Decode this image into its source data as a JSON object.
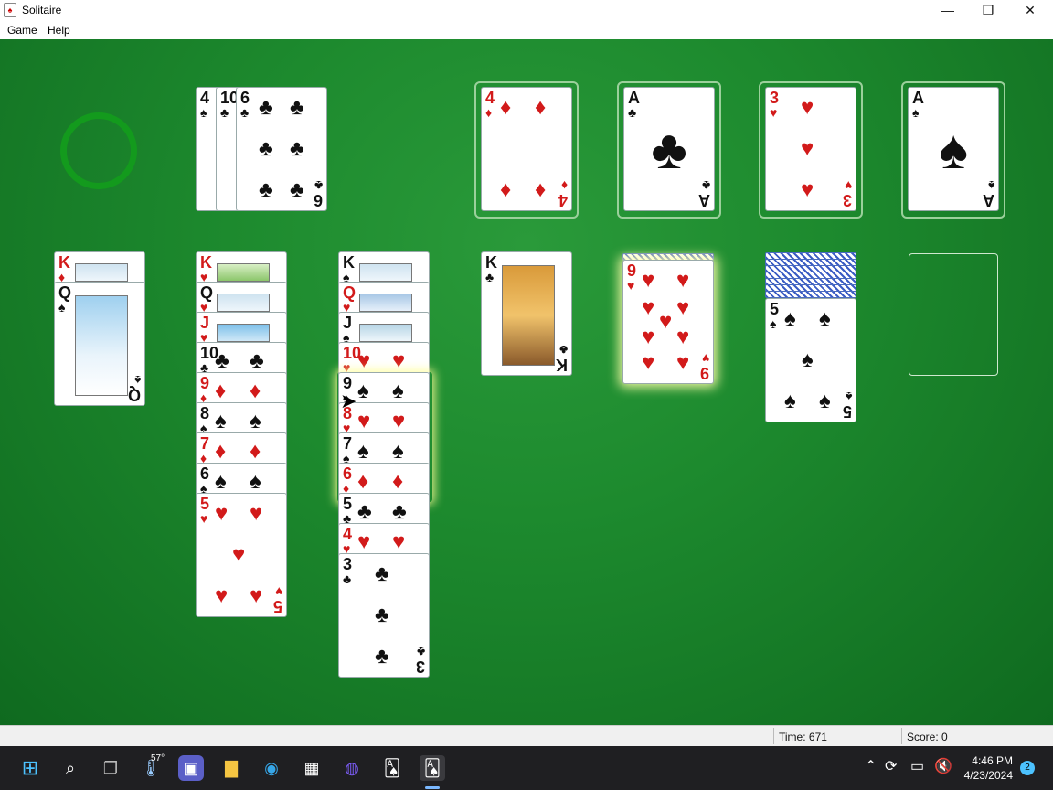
{
  "window": {
    "title": "Solitaire",
    "minimize": "—",
    "restore": "❐",
    "close": "✕"
  },
  "menu": {
    "game": "Game",
    "help": "Help"
  },
  "cards": {
    "waste_1_rank": "4",
    "waste_1_suit": "♠",
    "waste_2_rank": "10",
    "waste_2_suit": "♣",
    "waste_3_rank": "6",
    "waste_3_suit": "♣",
    "fnd_1_rank": "4",
    "fnd_1_suit": "♦",
    "fnd_2_rank": "A",
    "fnd_2_suit": "♣",
    "fnd_3_rank": "3",
    "fnd_3_suit": "♥",
    "fnd_4_rank": "A",
    "fnd_4_suit": "♠",
    "t1": [
      {
        "rank": "K",
        "suit": "♦"
      },
      {
        "rank": "Q",
        "suit": "♠"
      }
    ],
    "t2": [
      {
        "rank": "K",
        "suit": "♥"
      },
      {
        "rank": "Q",
        "suit": "♥"
      },
      {
        "rank": "J",
        "suit": "♥"
      },
      {
        "rank": "10",
        "suit": "♣"
      },
      {
        "rank": "9",
        "suit": "♦"
      },
      {
        "rank": "8",
        "suit": "♠"
      },
      {
        "rank": "7",
        "suit": "♦"
      },
      {
        "rank": "6",
        "suit": "♠"
      },
      {
        "rank": "5",
        "suit": "♥"
      }
    ],
    "t3": [
      {
        "rank": "K",
        "suit": "♠"
      },
      {
        "rank": "Q",
        "suit": "♥"
      },
      {
        "rank": "J",
        "suit": "♠"
      },
      {
        "rank": "10",
        "suit": "♥"
      },
      {
        "rank": "9",
        "suit": "♠"
      },
      {
        "rank": "8",
        "suit": "♥"
      },
      {
        "rank": "7",
        "suit": "♠"
      },
      {
        "rank": "6",
        "suit": "♦"
      },
      {
        "rank": "5",
        "suit": "♣"
      },
      {
        "rank": "4",
        "suit": "♥"
      },
      {
        "rank": "3",
        "suit": "♣"
      }
    ],
    "t4": [
      {
        "rank": "K",
        "suit": "♣"
      }
    ],
    "t5": [
      {
        "rank": "9",
        "suit": "♥"
      }
    ],
    "t6": [
      {
        "rank": "5",
        "suit": "♠"
      }
    ]
  },
  "status": {
    "time_label": "Time:  671",
    "score_label": "Score: 0"
  },
  "taskbar": {
    "weather": "57°",
    "time": "4:46 PM",
    "date": "4/23/2024",
    "notifications": "2"
  },
  "colors": {
    "felt": "#1d8a2e",
    "red_suit": "#d21a1a",
    "black_suit": "#111111"
  }
}
